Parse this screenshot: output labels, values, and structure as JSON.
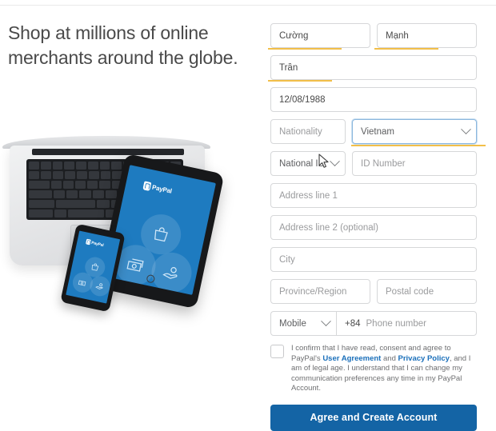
{
  "left_panel": {
    "headline": "Shop at millions of online merchants around the globe.",
    "illustration": {
      "brand_text": "PayPal",
      "device_screen_color": "#1e7bc0",
      "icons": [
        "shopping-bag-icon",
        "cash-icon",
        "hand-coin-icon"
      ]
    }
  },
  "form": {
    "first_name": {
      "value": "Cường",
      "autofill_underline": true
    },
    "middle_name": {
      "value": "Mạnh",
      "autofill_underline": true
    },
    "last_name": {
      "value": "Trần",
      "autofill_underline": true
    },
    "date_of_birth": {
      "value": "12/08/1988"
    },
    "nationality": {
      "label": "Nationality",
      "selected": "Vietnam",
      "focused": true,
      "autofill_underline": true
    },
    "id_type": {
      "selected": "National ID"
    },
    "id_number": {
      "placeholder": "ID Number"
    },
    "address_line_1": {
      "placeholder": "Address line 1"
    },
    "address_line_2": {
      "placeholder": "Address line 2 (optional)"
    },
    "city": {
      "placeholder": "City"
    },
    "province": {
      "placeholder": "Province/Region"
    },
    "postal_code": {
      "placeholder": "Postal code"
    },
    "phone": {
      "type_selected": "Mobile",
      "country_code": "+84",
      "placeholder": "Phone number"
    },
    "consent": {
      "checked": false,
      "text_part_1": "I confirm that I have read, consent and agree to PayPal's ",
      "link_1": "User Agreement",
      "text_part_2": " and ",
      "link_2": "Privacy Policy",
      "text_part_3": ", and I am of legal age. I understand that I can change my communication preferences any time in my PayPal Account."
    },
    "submit_label": "Agree and Create Account"
  },
  "colors": {
    "paypal_blue": "#1464a5",
    "device_blue": "#1e7bc0",
    "link_blue": "#1a6fba",
    "autofill_yellow": "#f0b429",
    "border_gray": "#d6d7d9"
  }
}
